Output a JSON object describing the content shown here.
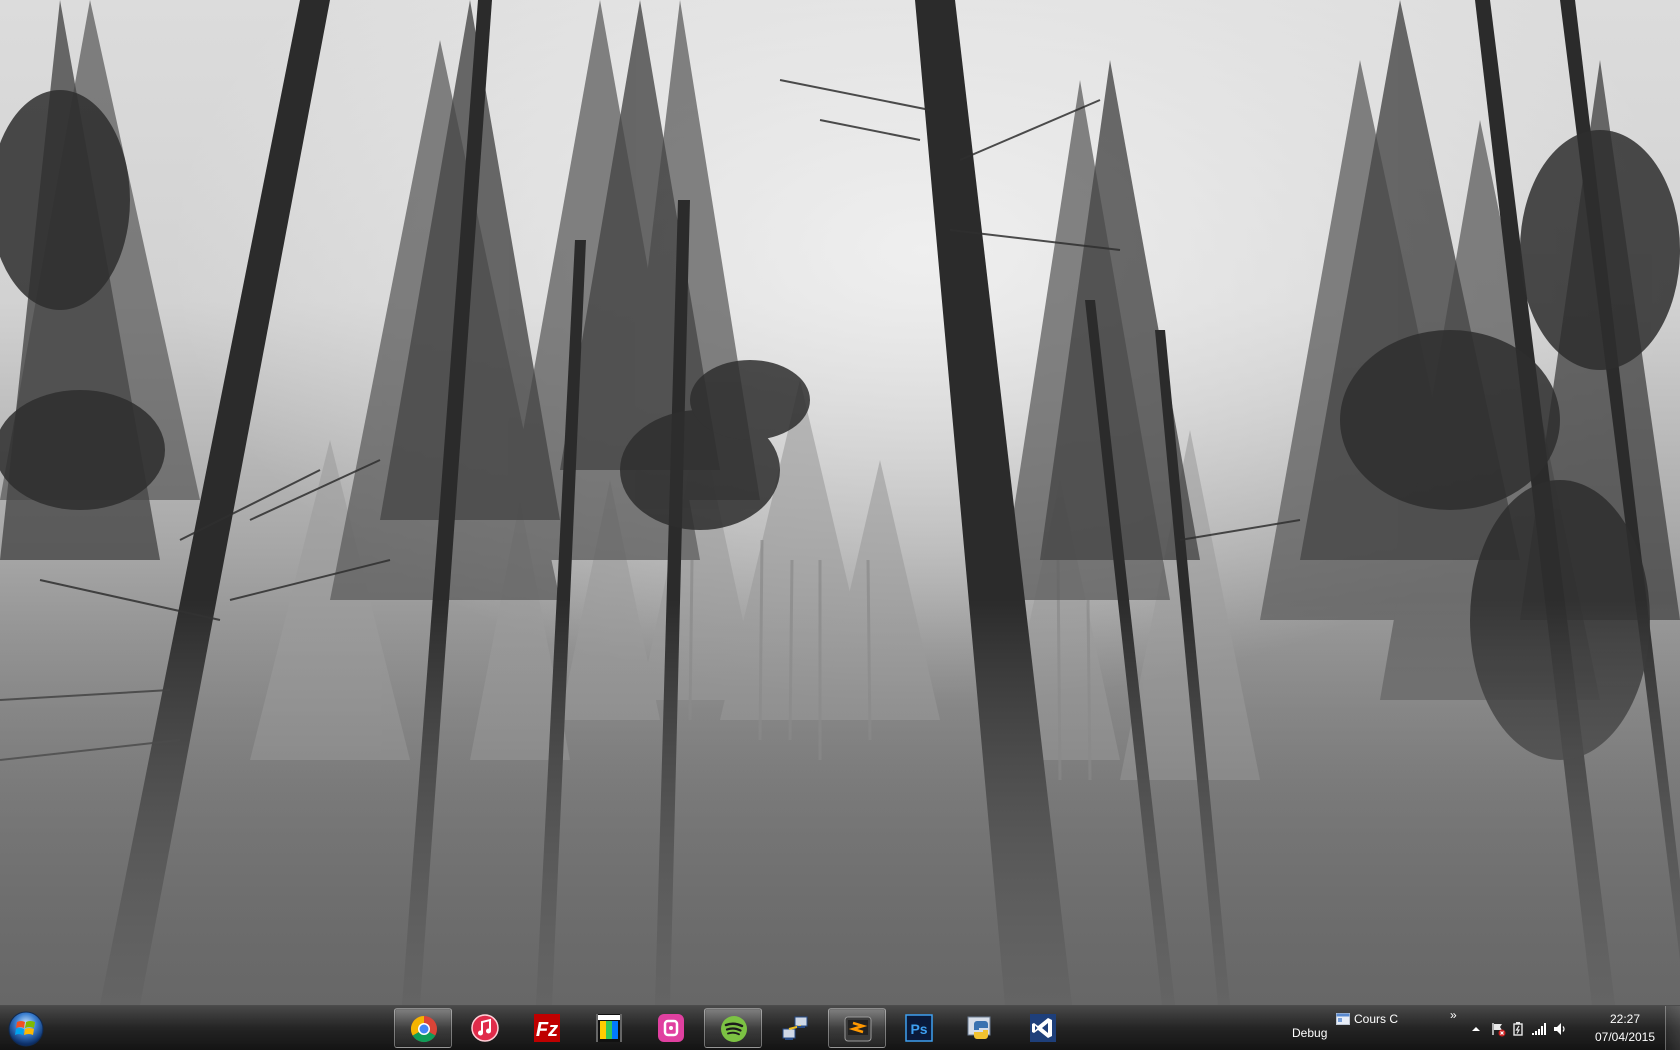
{
  "desktop": {
    "wallpaper_icon": "foggy-forest-wallpaper"
  },
  "taskbar": {
    "start_icon": "windows-start-orb",
    "pinned": [
      {
        "icon": "chrome-icon",
        "active": true
      },
      {
        "icon": "itunes-icon",
        "active": false
      },
      {
        "icon": "filezilla-icon",
        "active": false
      },
      {
        "icon": "movie-studio-icon",
        "active": false
      },
      {
        "icon": "pink-app-icon",
        "active": false
      },
      {
        "icon": "spotify-icon",
        "active": true
      },
      {
        "icon": "network-tool-icon",
        "active": false
      },
      {
        "icon": "sublime-text-icon",
        "active": true
      },
      {
        "icon": "photoshop-icon",
        "active": false
      },
      {
        "icon": "python-icon",
        "active": false
      },
      {
        "icon": "visual-studio-icon",
        "active": false
      }
    ],
    "toolbars": {
      "debug_label": "Debug",
      "cours_label": "Cours C",
      "more_label": "»"
    },
    "tray": {
      "overflow_icon": "up-arrow-icon",
      "icons": [
        "action-center-flag-icon",
        "power-icon",
        "network-signal-icon",
        "volume-icon"
      ],
      "time": "22:27",
      "date": "07/04/2015"
    }
  }
}
